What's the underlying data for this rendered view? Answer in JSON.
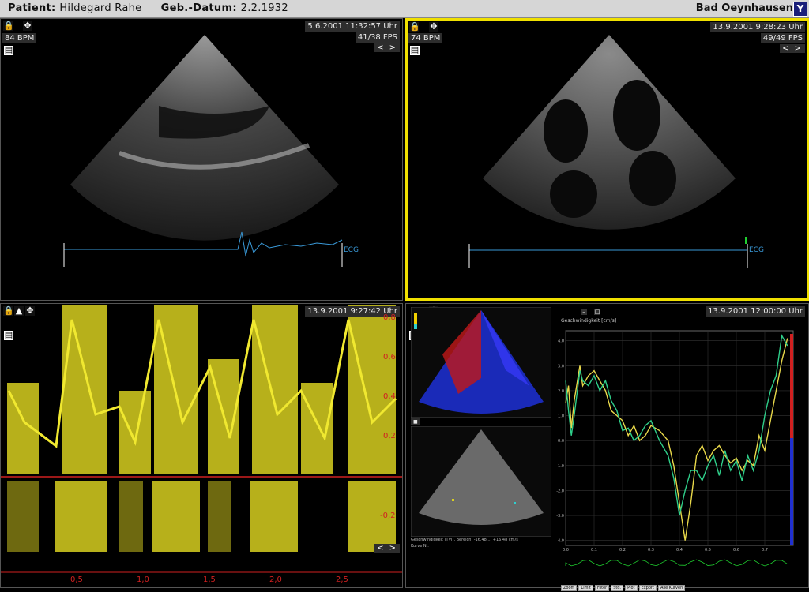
{
  "header": {
    "patient_label": "Patient:",
    "patient_name": "Hildegard Rahe",
    "dob_label": "Geb.-Datum:",
    "dob_value": "2.2.1932",
    "location": "Bad Oeynhausen",
    "logo": "Y"
  },
  "panel1": {
    "timestamp": "5.6.2001 11:32:57 Uhr",
    "bpm": "84 BPM",
    "fps": "41/38 FPS",
    "ecg_label": "ECG",
    "nav": "< >"
  },
  "panel2": {
    "timestamp": "13.9.2001 9:28:23 Uhr",
    "bpm": "74 BPM",
    "fps": "49/49 FPS",
    "ecg_label": "ECG",
    "nav": "< >"
  },
  "panel3": {
    "timestamp": "13.9.2001 9:27:42 Uhr",
    "nav": "< >",
    "y_ticks": [
      "0,8",
      "0,6",
      "0,4",
      "0,2",
      "-0,2"
    ],
    "x_ticks": [
      "0,5",
      "1,0",
      "1,5",
      "2,0",
      "2,5"
    ]
  },
  "panel4": {
    "timestamp": "13.9.2001 12:00:00 Uhr",
    "velocity_title": "Geschwindigkeit [cm/s]",
    "status_line": "Geschwindigkeit [TVI], Bereich: -16,48 ... +16,48 cm/s",
    "curve_label": "Kurve Nr.",
    "chart_y_ticks": [
      "4.0",
      "3.0",
      "2.0",
      "1.0",
      "0.0",
      "-1.0",
      "-2.0",
      "-3.0",
      "-4.0"
    ],
    "chart_x_ticks": [
      "0.0",
      "0.1",
      "0.2",
      "0.3",
      "0.4",
      "0.5",
      "0.6",
      "0.7"
    ],
    "buttons": [
      "Zoom",
      "Limit",
      "Filter",
      "Std.",
      "Plot",
      "Export",
      "Alle Kurven"
    ]
  },
  "chart_data": {
    "type": "line",
    "ylim": [
      -4.2,
      4.4
    ],
    "xlim": [
      0,
      0.8
    ],
    "series": [
      {
        "color": "#e8d84a",
        "x": [
          0,
          0.01,
          0.02,
          0.03,
          0.05,
          0.06,
          0.08,
          0.1,
          0.12,
          0.14,
          0.16,
          0.18,
          0.2,
          0.22,
          0.24,
          0.26,
          0.28,
          0.3,
          0.33,
          0.36,
          0.38,
          0.4,
          0.42,
          0.44,
          0.46,
          0.48,
          0.5,
          0.52,
          0.54,
          0.56,
          0.58,
          0.6,
          0.62,
          0.64,
          0.66,
          0.68,
          0.7,
          0.72,
          0.74,
          0.76,
          0.78
        ],
        "y": [
          1.5,
          2.2,
          0.5,
          1.6,
          3.0,
          2.2,
          2.6,
          2.8,
          2.4,
          2.0,
          1.2,
          1.0,
          0.8,
          0.2,
          0.6,
          0.0,
          0.2,
          0.6,
          0.4,
          0.0,
          -1.0,
          -2.5,
          -4.0,
          -2.5,
          -0.6,
          -0.2,
          -0.8,
          -0.4,
          -0.2,
          -0.6,
          -0.9,
          -0.7,
          -1.2,
          -0.8,
          -1.0,
          0.2,
          -0.4,
          0.8,
          2.0,
          3.2,
          4.1
        ]
      },
      {
        "color": "#2fcf8a",
        "x": [
          0,
          0.01,
          0.02,
          0.03,
          0.05,
          0.06,
          0.08,
          0.1,
          0.12,
          0.14,
          0.16,
          0.18,
          0.2,
          0.22,
          0.24,
          0.26,
          0.28,
          0.3,
          0.33,
          0.36,
          0.38,
          0.4,
          0.42,
          0.44,
          0.46,
          0.48,
          0.5,
          0.52,
          0.54,
          0.56,
          0.58,
          0.6,
          0.62,
          0.64,
          0.66,
          0.68,
          0.7,
          0.72,
          0.74,
          0.76,
          0.78
        ],
        "y": [
          2.4,
          1.2,
          0.2,
          1.0,
          2.8,
          2.4,
          2.2,
          2.6,
          2.0,
          2.4,
          1.6,
          1.2,
          0.4,
          0.5,
          0.0,
          0.2,
          0.6,
          0.8,
          0.0,
          -0.6,
          -1.5,
          -3.0,
          -2.0,
          -1.2,
          -1.2,
          -1.6,
          -1.0,
          -0.6,
          -1.4,
          -0.4,
          -1.2,
          -0.8,
          -1.6,
          -0.6,
          -1.2,
          -0.4,
          1.0,
          2.0,
          2.6,
          4.2,
          3.8
        ]
      }
    ]
  }
}
